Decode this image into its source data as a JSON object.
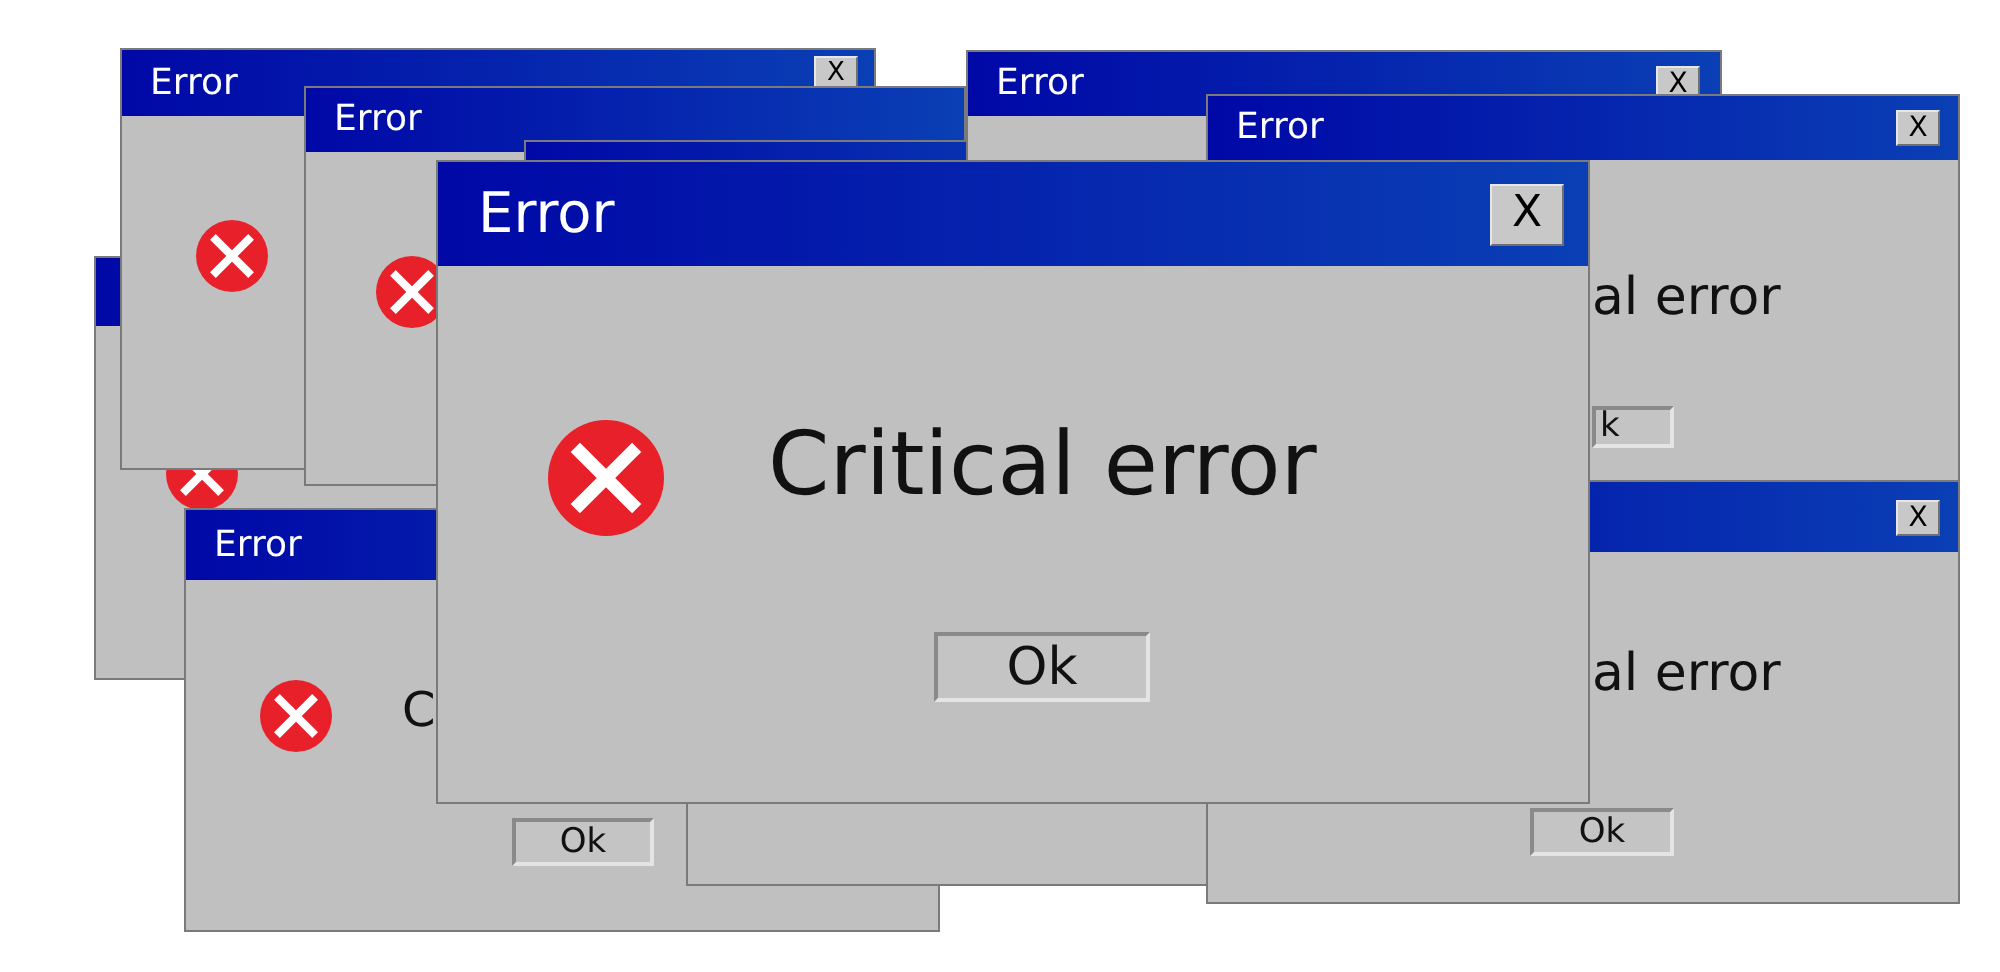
{
  "windows": [
    {
      "kind": "alert"
    },
    {
      "kind": "alert",
      "title": "Error",
      "close": "X"
    },
    {
      "kind": "alert",
      "title": "Error"
    },
    {
      "kind": "blank"
    },
    {
      "kind": "alert",
      "title": "Error",
      "message": "C",
      "ok": "Ok"
    },
    {
      "kind": "blank"
    },
    {
      "kind": "dialog",
      "title": "Error",
      "close": "X"
    },
    {
      "kind": "dialog",
      "title": "Error",
      "close": "X",
      "message": "al error",
      "ok": "k"
    },
    {
      "kind": "dialog",
      "close": "X",
      "message": "al error",
      "ok": "Ok"
    },
    {
      "kind": "alert",
      "title": "Error",
      "close": "X",
      "message": "Critical error",
      "ok": "Ok"
    }
  ]
}
